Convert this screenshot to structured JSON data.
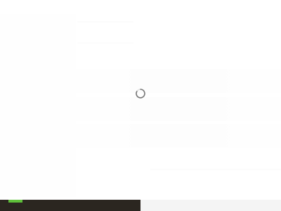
{
  "page": {
    "state": "loading",
    "loading_indicator": "spinner-icon"
  },
  "colors": {
    "background": "#ffffff",
    "bottom_bar": "#2b2620",
    "bottom_accent": "#5fbf3a",
    "spinner": "#777777"
  }
}
